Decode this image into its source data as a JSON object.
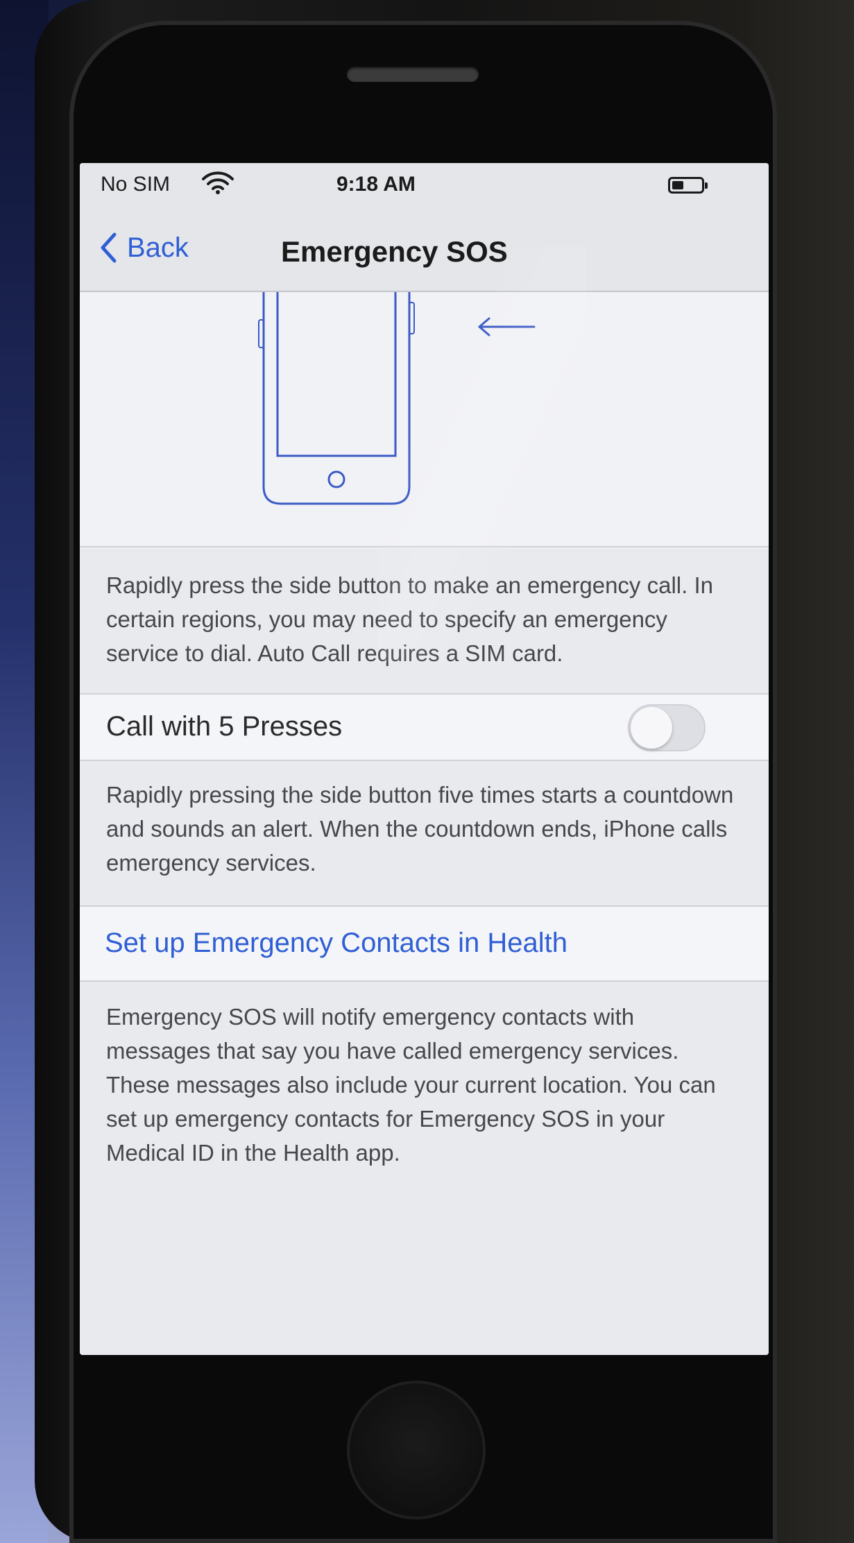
{
  "status_bar": {
    "carrier": "No SIM",
    "time": "9:18 AM"
  },
  "nav": {
    "back_label": "Back",
    "title": "Emergency SOS"
  },
  "sections": {
    "auto_call_description": "Rapidly press the side button to make an emergency call. In certain regions, you may need to specify an emergency service to dial. Auto Call requires a SIM card.",
    "call_with_5_presses": {
      "label": "Call with 5 Presses",
      "enabled": false
    },
    "five_presses_description": "Rapidly pressing the side button five times starts a countdown and sounds an alert. When the countdown ends, iPhone calls emergency services.",
    "setup_contacts_link": "Set up Emergency Contacts in Health",
    "contacts_description": "Emergency SOS will notify emergency contacts with messages that say you have called emergency services. These messages also include your current location. You can set up emergency contacts for Emergency SOS in your Medical ID in the Health app."
  },
  "colors": {
    "accent": "#2f5fd4",
    "toggle_off": "#dddfe4",
    "background": "#eceef3"
  },
  "icons": [
    "wifi-icon",
    "battery-icon",
    "chevron-left-icon",
    "side-button-phone-illustration",
    "arrow-left-icon"
  ]
}
